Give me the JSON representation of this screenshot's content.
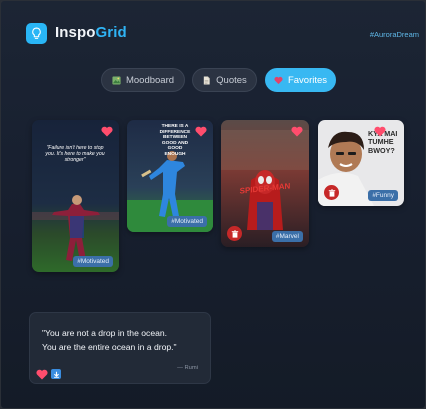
{
  "header": {
    "brand_primary": "Inspo",
    "brand_accent": "Grid",
    "hashtag": "#AuroraDream"
  },
  "tabs": [
    {
      "label": "Moodboard",
      "icon": "image-icon",
      "active": false
    },
    {
      "label": "Quotes",
      "icon": "document-icon",
      "active": false
    },
    {
      "label": "Favorites",
      "icon": "heart-icon",
      "active": true
    }
  ],
  "cards": [
    {
      "tag": "#Motivated",
      "overlay": "\"Failure isn't here to stop you. It's here to make you stronger\""
    },
    {
      "tag": "#Motivated",
      "overlay": "THERE IS A DIFFERENCE BETWEEN GOOD AND GOOD ENOUGH"
    },
    {
      "tag": "#Marvel",
      "overlay": "SPIDER-MAN"
    },
    {
      "tag": "#Funny",
      "overlay": "KYA MAI TUMHE BWOY?"
    }
  ],
  "quote": {
    "text_line1": "\"You are not a drop in the ocean.",
    "text_line2": "You are the entire ocean in a drop.\"",
    "author": "— Rumi"
  },
  "colors": {
    "accent": "#38b8f2",
    "heart": "#ff4d6d",
    "tag_bg": "#3b6fa8",
    "delete": "#c62828"
  }
}
